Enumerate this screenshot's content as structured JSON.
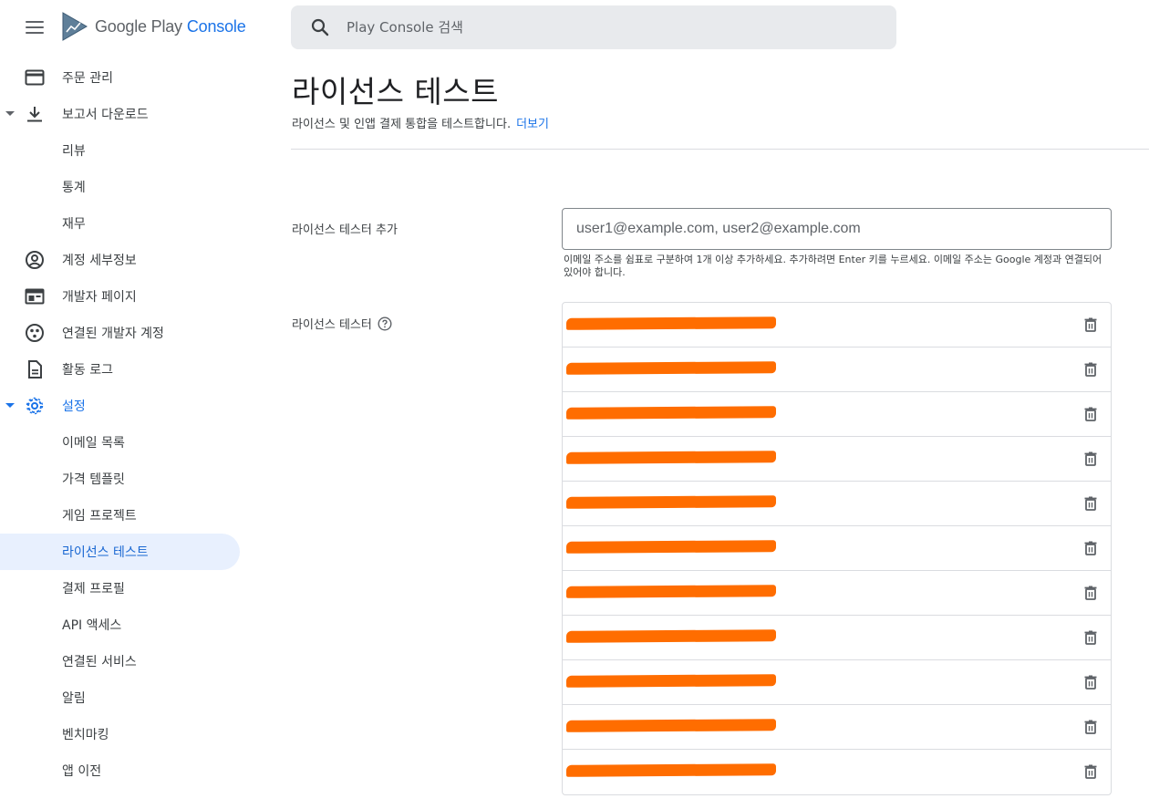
{
  "brand": {
    "google": "Google Play",
    "console": "Console"
  },
  "search": {
    "placeholder": "Play Console 검색"
  },
  "nav": {
    "items": [
      {
        "label": "주문 관리"
      },
      {
        "label": "보고서 다운로드"
      },
      {
        "label": "리뷰"
      },
      {
        "label": "통계"
      },
      {
        "label": "재무"
      },
      {
        "label": "계정 세부정보"
      },
      {
        "label": "개발자 페이지"
      },
      {
        "label": "연결된 개발자 계정"
      },
      {
        "label": "활동 로그"
      },
      {
        "label": "설정"
      },
      {
        "label": "이메일 목록"
      },
      {
        "label": "가격 템플릿"
      },
      {
        "label": "게임 프로젝트"
      },
      {
        "label": "라이선스 테스트"
      },
      {
        "label": "결제 프로필"
      },
      {
        "label": "API 액세스"
      },
      {
        "label": "연결된 서비스"
      },
      {
        "label": "알림"
      },
      {
        "label": "벤치마킹"
      },
      {
        "label": "앱 이전"
      }
    ]
  },
  "main": {
    "title": "라이선스 테스트",
    "subtitle": "라이선스 및 인앱 결제 통합을 테스트합니다.",
    "learn_more": "더보기",
    "add_tester_label": "라이선스 테스터 추가",
    "add_tester_input_value": "",
    "add_tester_placeholder": "user1@example.com, user2@example.com",
    "hint": "이메일 주소를 쉼표로 구분하여 1개 이상 추가하세요. 추가하려면 Enter 키를 누르세요. 이메일 주소는 Google 계정과 연결되어 있어야 합니다.",
    "testers_label": "라이선스 테스터",
    "testers": [
      {
        "email": "",
        "redacted": true
      },
      {
        "email": "",
        "redacted": true
      },
      {
        "email": "",
        "redacted": true
      },
      {
        "email": "",
        "redacted": true
      },
      {
        "email": "",
        "redacted": true
      },
      {
        "email": "",
        "redacted": true
      },
      {
        "email": "",
        "redacted": true
      },
      {
        "email": "",
        "redacted": true
      },
      {
        "email": "",
        "redacted": true
      },
      {
        "email": "",
        "redacted": true
      },
      {
        "email": "",
        "redacted": true
      }
    ]
  },
  "colors": {
    "accent": "#1a73e8",
    "redaction": "#ff6d00",
    "active_bg": "#e8f0fe"
  }
}
